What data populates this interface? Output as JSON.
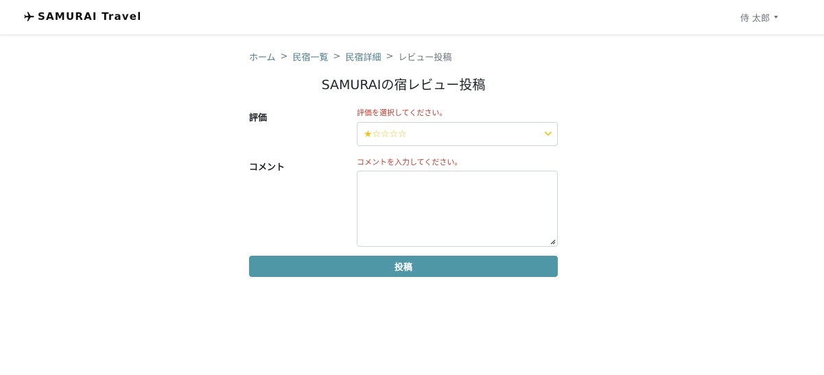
{
  "header": {
    "brand_text": "SAMURAI Travel",
    "user_name": "侍 太郎"
  },
  "breadcrumb": {
    "items": [
      "ホーム",
      "民宿一覧",
      "民宿詳細"
    ],
    "separator": ">",
    "current": "レビュー投稿"
  },
  "page": {
    "title": "SAMURAIの宿レビュー投稿"
  },
  "form": {
    "rating": {
      "label": "評価",
      "error": "評価を選択してください。",
      "selected_value": "★☆☆☆☆"
    },
    "comment": {
      "label": "コメント",
      "error": "コメントを入力してください。",
      "value": ""
    },
    "submit_label": "投稿"
  },
  "colors": {
    "accent": "#4f97a7",
    "link": "#4f7b8e",
    "error": "#c0392b",
    "star": "#f0c419"
  }
}
